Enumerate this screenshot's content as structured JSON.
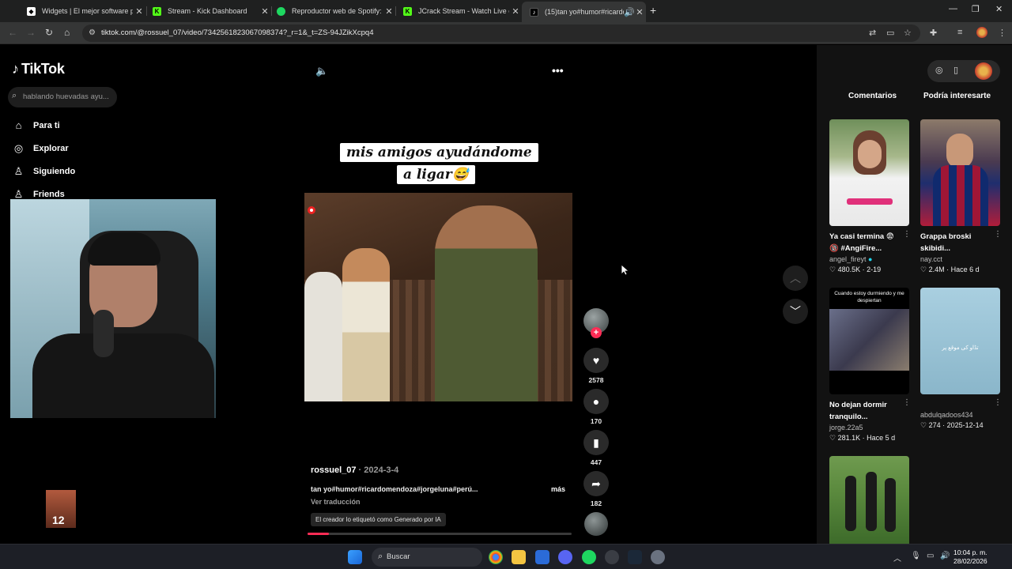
{
  "browser": {
    "tabs": [
      {
        "title": "Widgets | El mejor software para",
        "color": "#ffffff"
      },
      {
        "title": "Stream - Kick Dashboard",
        "color": "#53fc18"
      },
      {
        "title": "Reproductor web de Spotify: m",
        "color": "#1ed760"
      },
      {
        "title": "JCrack Stream - Watch Live on K",
        "color": "#53fc18"
      },
      {
        "title": "(15)tan yo#humor#ricardom",
        "color": "#ffffff"
      }
    ],
    "url": "tiktok.com/@rossuel_07/video/7342561823067098374?_r=1&_t=ZS-94JZikXcpq4"
  },
  "sidebar": {
    "brand": "TikTok",
    "search_placeholder": "hablando huevadas ayu...",
    "items": [
      {
        "label": "Para ti",
        "icon": "home-icon"
      },
      {
        "label": "Explorar",
        "icon": "compass-icon"
      },
      {
        "label": "Siguiendo",
        "icon": "user-icon"
      },
      {
        "label": "Friends",
        "icon": "friends-icon"
      }
    ],
    "sticker_text": "12"
  },
  "video": {
    "caption_line1": "mis amigos ayudándome",
    "caption_line2": "a ligar😅",
    "author": "rossuel_07",
    "date": "· 2024-3-4",
    "description": "tan yo#humor#ricardomendoza#jorgeluna#perú...",
    "more_label": "más",
    "translate_label": "Ver traducción",
    "ai_label": "El creador lo etiquetó como Generado por IA",
    "progress": 0.08,
    "likes": "2578",
    "comments": "170",
    "saves": "447",
    "shares": "182"
  },
  "right_panel": {
    "tabs": [
      "Comentarios",
      "Podría interesarte"
    ],
    "cards": [
      {
        "title": "Ya casi termina 😨 🔞 #AngiFire...",
        "user": "angel_fireyt",
        "likes": "480.5K",
        "when": "2-19",
        "verified": true
      },
      {
        "title": "Grappa broski skibidi...",
        "user": "nay.cct",
        "likes": "2.4M",
        "when": "Hace 6 d",
        "verified": false
      },
      {
        "title": "No dejan dormir tranquilo...",
        "user": "jorge.22a5",
        "likes": "281.1K",
        "when": "Hace 5 d",
        "verified": false,
        "thumb_text": "Cuando estoy durmiendo y me despiertan"
      },
      {
        "title": "",
        "user": "abdulqadoos434",
        "likes": "274",
        "when": "2025-12-14",
        "verified": false,
        "thumb_text": "تڈاو کی موقع پر"
      },
      {
        "title": "",
        "user": "",
        "likes": "",
        "when": "",
        "verified": false
      }
    ]
  },
  "taskbar": {
    "search": "Buscar",
    "time": "10:04 p. m.",
    "date": "28/02/2026"
  }
}
